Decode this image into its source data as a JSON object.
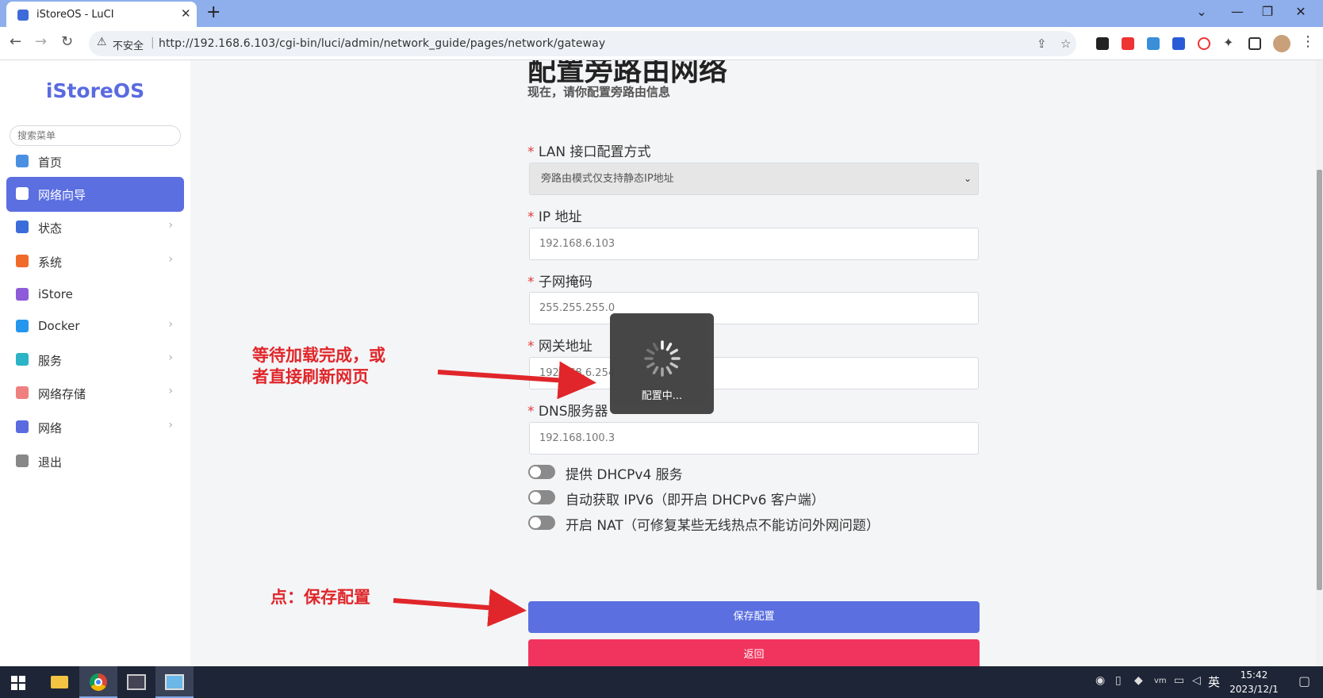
{
  "browser": {
    "tab_title": "iStoreOS - LuCI",
    "tab_close": "✕",
    "new_tab": "+",
    "security_label": "不安全",
    "url": "http://192.168.6.103/cgi-bin/luci/admin/network_guide/pages/network/gateway",
    "window_controls": [
      "⌄",
      "—",
      "❐",
      "✕"
    ]
  },
  "sidebar": {
    "logo": "iStoreOS",
    "search_placeholder": "搜索菜单",
    "items": [
      {
        "label": "首页",
        "icon": "dashboard-icon",
        "color": "#4a90e2",
        "active": false,
        "chevron": ""
      },
      {
        "label": "网络向导",
        "icon": "globe-icon",
        "color": "#ffffff",
        "active": true,
        "chevron": ""
      },
      {
        "label": "状态",
        "icon": "grid-icon",
        "color": "#3b6cd9",
        "active": false,
        "chevron": "›"
      },
      {
        "label": "系统",
        "icon": "gear-icon",
        "color": "#f06a2a",
        "active": false,
        "chevron": "›"
      },
      {
        "label": "iStore",
        "icon": "bag-icon",
        "color": "#8e5cd9",
        "active": false,
        "chevron": ""
      },
      {
        "label": "Docker",
        "icon": "docker-icon",
        "color": "#2496ed",
        "active": false,
        "chevron": "›"
      },
      {
        "label": "服务",
        "icon": "services-icon",
        "color": "#2bb3c7",
        "active": false,
        "chevron": "›"
      },
      {
        "label": "网络存储",
        "icon": "database-icon",
        "color": "#f08080",
        "active": false,
        "chevron": "›"
      },
      {
        "label": "网络",
        "icon": "network-icon",
        "color": "#5a6be0",
        "active": false,
        "chevron": "›"
      },
      {
        "label": "退出",
        "icon": "logout-icon",
        "color": "#888888",
        "active": false,
        "chevron": ""
      }
    ]
  },
  "page": {
    "title": "配置旁路由网络",
    "subtitle": "现在，请你配置旁路由信息",
    "required_mark": "*",
    "fields": {
      "lan_mode": {
        "label": "LAN 接口配置方式",
        "value": "旁路由模式仅支持静态IP地址"
      },
      "ip": {
        "label": "IP 地址",
        "value": "192.168.6.103"
      },
      "netmask": {
        "label": "子网掩码",
        "value": "255.255.255.0"
      },
      "gateway": {
        "label": "网关地址",
        "value": "192.168.6.254"
      },
      "dns": {
        "label": "DNS服务器",
        "value": "192.168.100.3"
      }
    },
    "toggles": [
      {
        "label": "提供 DHCPv4 服务",
        "on": false
      },
      {
        "label": "自动获取 IPV6（即开启 DHCPv6 客户端）",
        "on": false
      },
      {
        "label": "开启 NAT（可修复某些无线热点不能访问外网问题）",
        "on": false
      }
    ],
    "save_button": "保存配置",
    "back_button": "返回"
  },
  "loading": {
    "text": "配置中..."
  },
  "annotations": {
    "wait_line1": "等待加载完成，或",
    "wait_line2": "者直接刷新网页",
    "click_save": "点：保存配置",
    "color": "#e0262a"
  },
  "taskbar": {
    "ime": "英",
    "time": "15:42",
    "date": "2023/12/1"
  },
  "colors": {
    "accent": "#5b6fe1",
    "danger": "#f0345d",
    "required": "#e03a3a"
  }
}
